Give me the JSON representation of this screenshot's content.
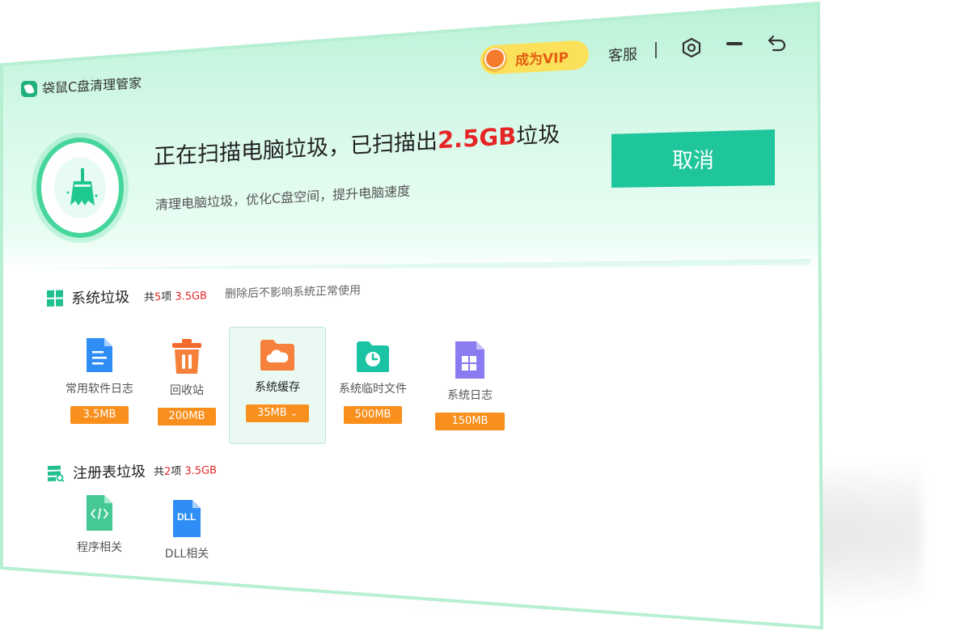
{
  "app": {
    "title": "袋鼠C盘清理管家"
  },
  "topbar": {
    "vip_label": "成为VIP",
    "service_label": "客服",
    "separator": "|"
  },
  "banner": {
    "title_prefix": "正在扫描电脑垃圾，已扫描出",
    "title_highlight": "2.5GB",
    "title_suffix": "垃圾",
    "subtitle": "清理电脑垃圾，优化C盘空间，提升电脑速度",
    "cancel_label": "取消"
  },
  "system_junk": {
    "title": "系统垃圾",
    "count_prefix": "共",
    "count": "5",
    "count_suffix": "项",
    "size": "3.5GB",
    "note": "删除后不影响系统正常使用",
    "items": [
      {
        "label": "常用软件日志",
        "size": "3.5MB"
      },
      {
        "label": "回收站",
        "size": "200MB"
      },
      {
        "label": "系统缓存",
        "size": "35MB"
      },
      {
        "label": "系统临时文件",
        "size": "500MB"
      },
      {
        "label": "系统日志",
        "size": "150MB"
      }
    ]
  },
  "registry_junk": {
    "title": "注册表垃圾",
    "count_prefix": "共",
    "count": "2",
    "count_suffix": "项",
    "size": "3.5GB",
    "items": [
      {
        "label": "程序相关"
      },
      {
        "label": "DLL相关"
      }
    ]
  },
  "colors": {
    "accent": "#1fc69c",
    "highlight": "#e52525",
    "size_badge": "#f98f1c",
    "vip": "#fbe15a"
  }
}
